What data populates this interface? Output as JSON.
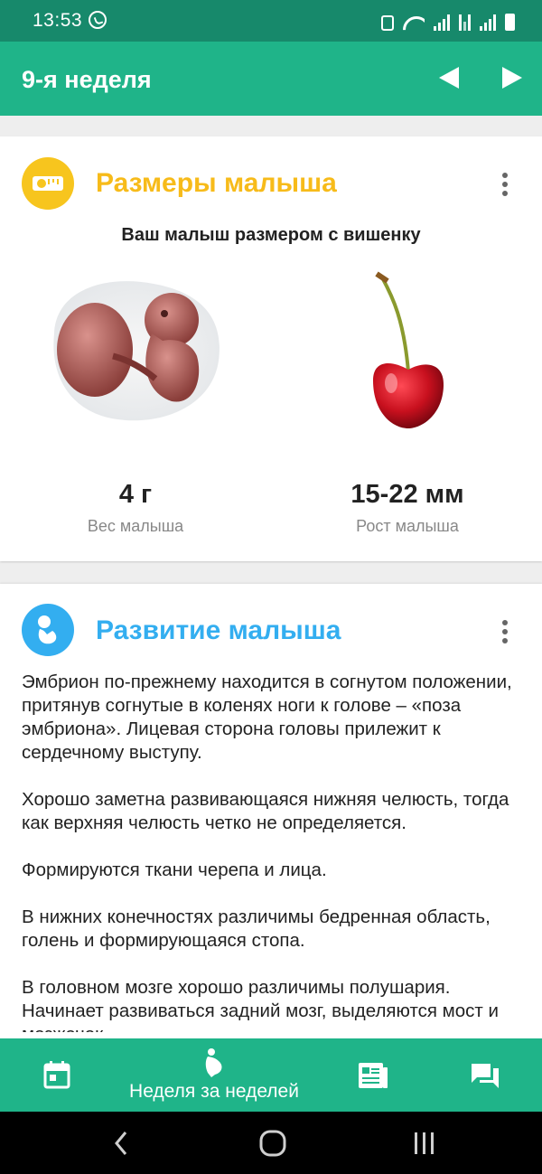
{
  "status_bar": {
    "time": "13:53",
    "icons": [
      "whatsapp-icon",
      "lock-icon",
      "wifi-icon",
      "signal-icon",
      "data-icon",
      "signal-icon",
      "battery-icon"
    ]
  },
  "app_bar": {
    "title": "9-я неделя",
    "prev_icon": "arrow-left-icon",
    "next_icon": "arrow-right-icon"
  },
  "size_card": {
    "title": "Размеры малыша",
    "title_color": "#f7bb1a",
    "icon": "tape-measure-icon",
    "icon_color": "#f7c51e",
    "caption": "Ваш малыш размером с вишенку",
    "weight": {
      "value": "4 г",
      "label": "Вес малыша"
    },
    "height": {
      "value": "15-22 мм",
      "label": "Рост малыша"
    }
  },
  "development_card": {
    "title": "Развитие малыша",
    "title_color": "#33aef0",
    "icon": "baby-icon",
    "icon_color": "#33aef0",
    "paragraphs": [
      "Эмбрион по-прежнему находится в согнутом положении, притянув согнутые в коленях ноги к голове – «поза эмбриона». Лицевая сторона головы прилежит к сердечному выступу.",
      "Хорошо заметна развивающаяся нижняя челюсть, тогда как верхняя челюсть четко не определяется.",
      "Формируются ткани черепа и лица.",
      "В нижних конечностях различимы бедренная область, голень и формирующаяся стопа.",
      "В головном мозге хорошо различимы полушария. Начинает развиваться задний мозг, выделяются мост и мозжечок."
    ]
  },
  "bottom_nav": {
    "items": [
      {
        "icon": "calendar-icon",
        "label": ""
      },
      {
        "icon": "pregnancy-icon",
        "label": "Неделя за неделей"
      },
      {
        "icon": "articles-icon",
        "label": ""
      },
      {
        "icon": "chat-icon",
        "label": ""
      }
    ],
    "background": "#1fb489"
  },
  "system_nav": {
    "icons": [
      "back-icon",
      "home-icon",
      "recents-icon"
    ]
  }
}
